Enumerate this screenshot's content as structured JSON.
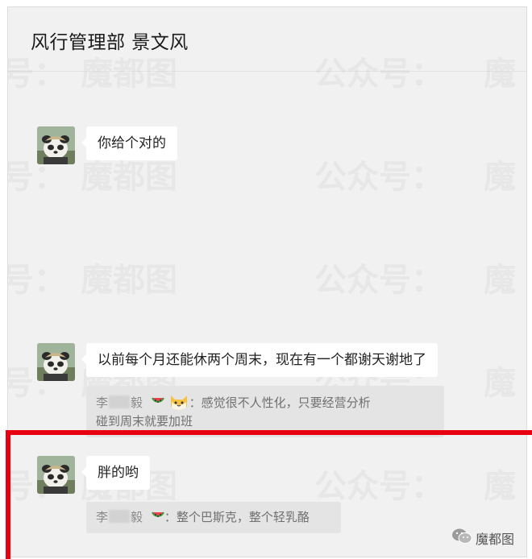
{
  "header": {
    "title": "风行管理部 景文风"
  },
  "watermark": {
    "parts": [
      "号：",
      "魔都图",
      "公众号：",
      "魔"
    ]
  },
  "messages": [
    {
      "text": "你给个对的"
    },
    {
      "text": "以前每个月还能休两个周末，现在有一个都谢天谢地了",
      "quote": {
        "name_prefix": "李",
        "name_suffix": "毅",
        "text_line1": "：感觉很不人性化，只要经营分析",
        "text_line2": "碰到周末就要加班"
      }
    },
    {
      "text": "胖的哟",
      "quote": {
        "name_prefix": "李",
        "name_suffix": "毅",
        "text_line1": "：整个巴斯克，整个轻乳酪"
      }
    }
  ],
  "source": {
    "label": "魔都图"
  },
  "colors": {
    "highlight": "#e60012",
    "chat_bg": "#f1f1f1"
  },
  "icons": [
    "panda-avatar-icon",
    "watermelon-icon",
    "cat-emoji-icon",
    "wechat-logo-icon"
  ]
}
